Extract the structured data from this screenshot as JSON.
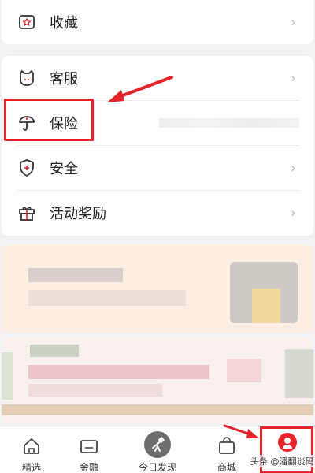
{
  "top_item": {
    "label": "收藏",
    "chevron": "›",
    "icon": "star-in-box-icon"
  },
  "menu": {
    "items": [
      {
        "label": "客服",
        "chevron": "›",
        "icon": "cat-face-icon"
      },
      {
        "label": "保险",
        "icon": "umbrella-icon"
      },
      {
        "label": "安全",
        "chevron": "›",
        "icon": "shield-plus-icon"
      },
      {
        "label": "活动奖励",
        "chevron": "›",
        "icon": "gift-icon"
      }
    ]
  },
  "tabbar": {
    "tabs": [
      {
        "label": "精选",
        "icon": "home-icon"
      },
      {
        "label": "金融",
        "icon": "wallet-card-icon"
      },
      {
        "label": "今日发现",
        "icon": "telescope-icon"
      },
      {
        "label": "商城",
        "icon": "shopping-bag-icon"
      },
      {
        "label": "",
        "icon": "profile-icon",
        "active": true
      }
    ]
  },
  "watermark": "头条 @潘翻谈码",
  "colors": {
    "annotation_red": "#e4232a",
    "active_tab": "#e4232a"
  }
}
